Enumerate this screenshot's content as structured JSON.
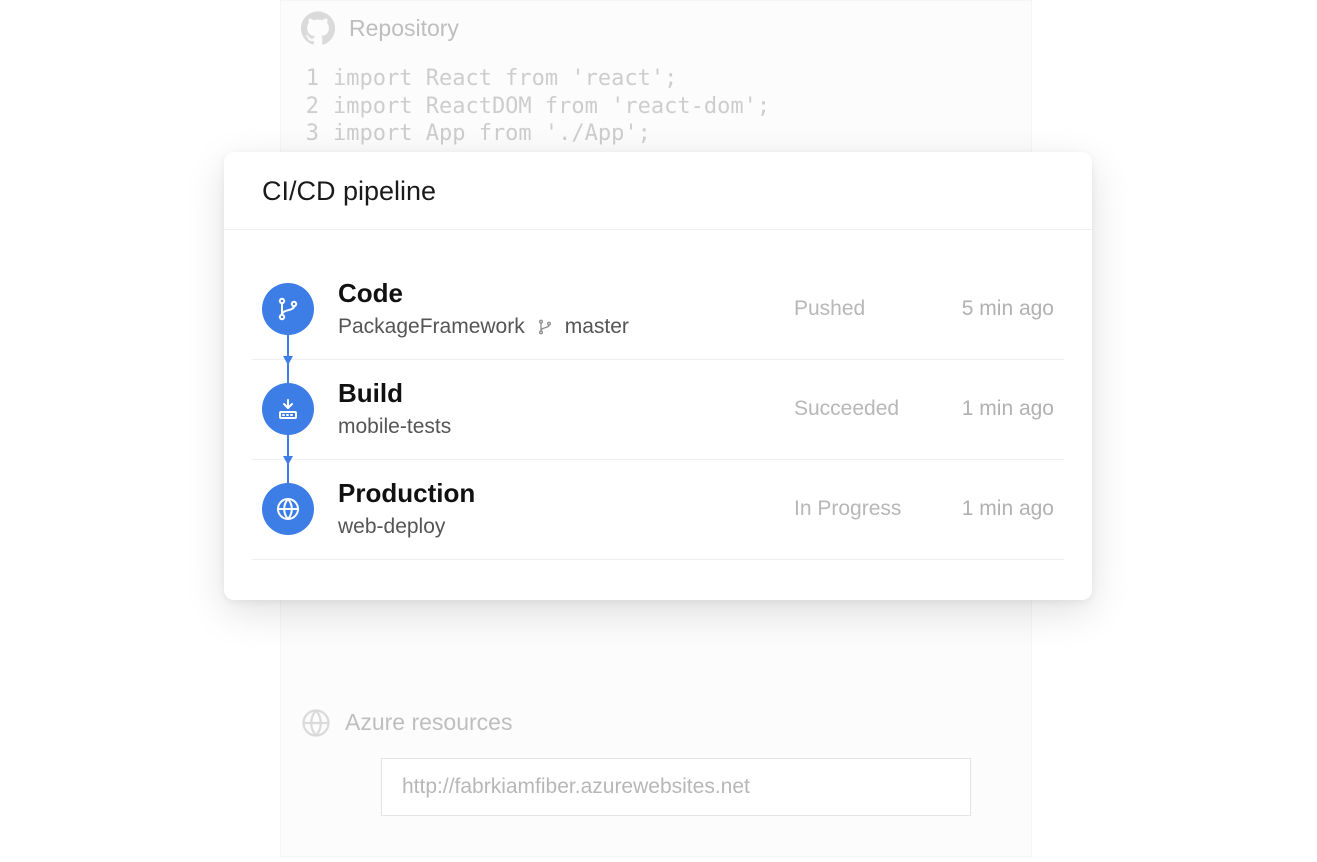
{
  "background": {
    "repositoryLabel": "Repository",
    "code": [
      {
        "num": "1",
        "text": "import React from 'react';"
      },
      {
        "num": "2",
        "text": "import ReactDOM from 'react-dom';"
      },
      {
        "num": "3",
        "text": "import App from './App';"
      }
    ],
    "azureLabel": "Azure resources",
    "url": "http://fabrkiamfiber.azurewebsites.net"
  },
  "pipeline": {
    "title": "CI/CD pipeline",
    "stages": [
      {
        "icon": "branch",
        "title": "Code",
        "subtitle": "PackageFramework",
        "branch": "master",
        "status": "Pushed",
        "time": "5 min ago"
      },
      {
        "icon": "build",
        "title": "Build",
        "subtitle": "mobile-tests",
        "branch": "",
        "status": "Succeeded",
        "time": "1 min ago"
      },
      {
        "icon": "globe",
        "title": "Production",
        "subtitle": "web-deploy",
        "branch": "",
        "status": "In Progress",
        "time": "1 min ago"
      }
    ]
  }
}
